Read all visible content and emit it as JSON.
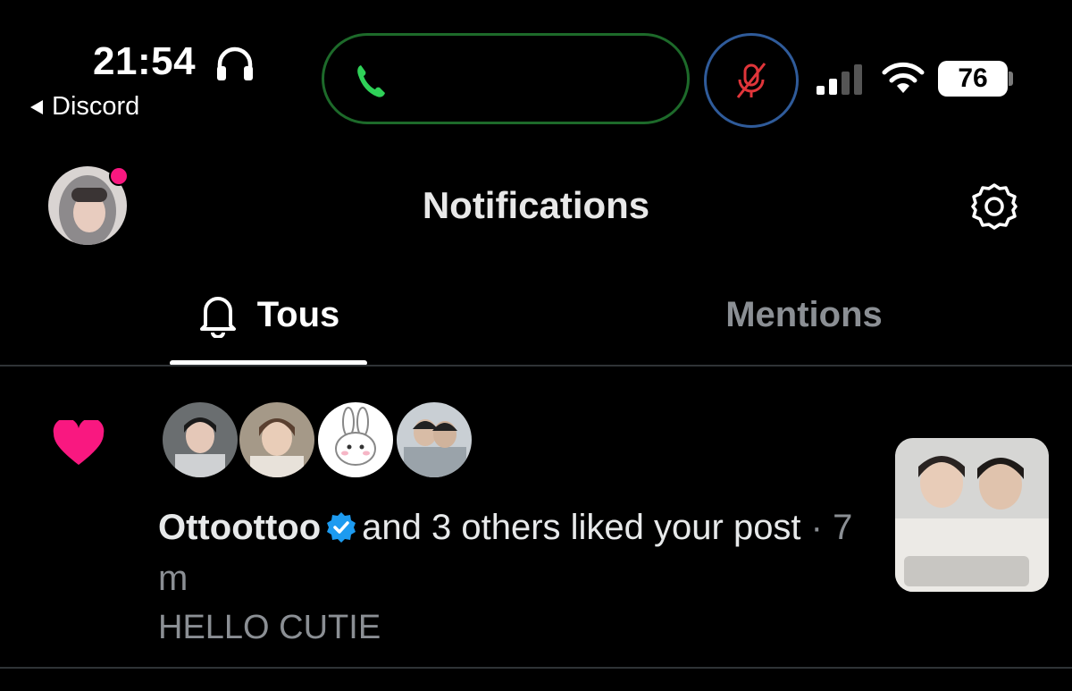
{
  "status_bar": {
    "time": "21:54",
    "back_app": "Discord",
    "battery": "76"
  },
  "header": {
    "title": "Notifications"
  },
  "tabs": [
    {
      "label": "Tous",
      "active": true
    },
    {
      "label": "Mentions",
      "active": false
    }
  ],
  "notification": {
    "type_icon": "heart-icon",
    "username": "Ottoottoo",
    "action": "and 3 others liked your post",
    "time": "· 7 m",
    "preview": "HELLO CUTIE",
    "liker_count": 4
  },
  "colors": {
    "accent_pink": "#f91880",
    "verified_blue": "#1d9bf0",
    "call_green": "#1d6a2a",
    "mute_red": "#e0353a"
  }
}
